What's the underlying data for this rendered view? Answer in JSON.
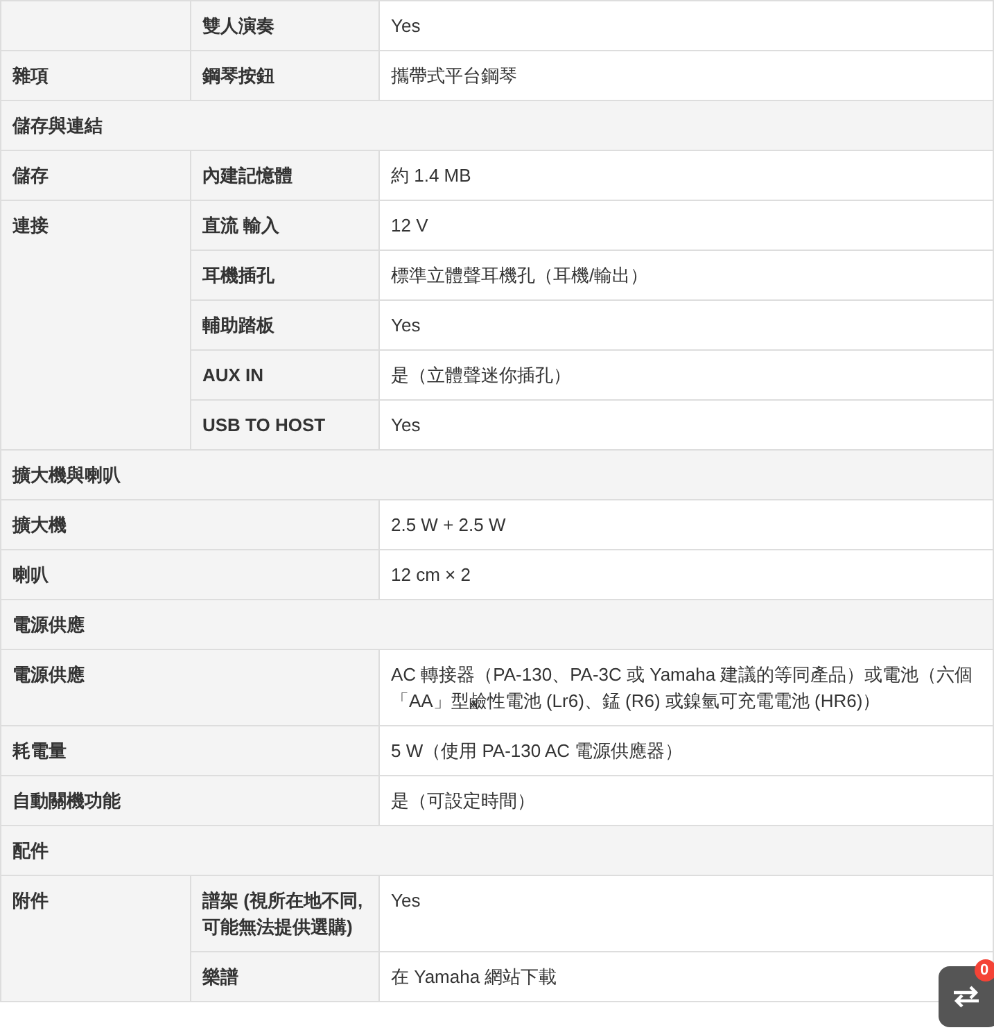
{
  "rows": [
    {
      "kind": "group",
      "items": [
        {
          "label": "雙人演奏",
          "value": "Yes"
        }
      ]
    },
    {
      "kind": "group",
      "category": "雜項",
      "items": [
        {
          "label": "鋼琴按鈕",
          "value": "攜帶式平台鋼琴"
        }
      ]
    },
    {
      "kind": "section",
      "title": "儲存與連結"
    },
    {
      "kind": "group",
      "category": "儲存",
      "items": [
        {
          "label": "內建記憶體",
          "value": "約 1.4 MB"
        }
      ]
    },
    {
      "kind": "group",
      "category": "連接",
      "items": [
        {
          "label": "直流 輸入",
          "value": "12 V"
        },
        {
          "label": "耳機插孔",
          "value": "標準立體聲耳機孔（耳機/輸出）"
        },
        {
          "label": "輔助踏板",
          "value": "Yes"
        },
        {
          "label": "AUX IN",
          "value": "是（立體聲迷你插孔）"
        },
        {
          "label": "USB TO HOST",
          "value": "Yes"
        }
      ]
    },
    {
      "kind": "section",
      "title": "擴大機與喇叭"
    },
    {
      "kind": "wide",
      "category": "擴大機",
      "value": "2.5 W + 2.5 W"
    },
    {
      "kind": "wide",
      "category": "喇叭",
      "value": "12 cm × 2"
    },
    {
      "kind": "section",
      "title": "電源供應"
    },
    {
      "kind": "wide",
      "category": "電源供應",
      "value": "AC 轉接器（PA-130、PA-3C 或 Yamaha 建議的等同產品）或電池（六個「AA」型鹼性電池 (Lr6)、錳 (R6) 或鎳氫可充電電池 (HR6)）"
    },
    {
      "kind": "wide",
      "category": "耗電量",
      "value": "5 W（使用 PA-130 AC 電源供應器）"
    },
    {
      "kind": "wide",
      "category": "自動關機功能",
      "value": "是（可設定時間）"
    },
    {
      "kind": "section",
      "title": "配件"
    },
    {
      "kind": "group",
      "category": "附件",
      "items": [
        {
          "label": "譜架 (視所在地不同, 可能無法提供選購)",
          "value": "Yes"
        },
        {
          "label": "樂譜",
          "value": "在 Yamaha 網站下載"
        }
      ]
    }
  ],
  "compare_widget": {
    "badge": "0"
  }
}
